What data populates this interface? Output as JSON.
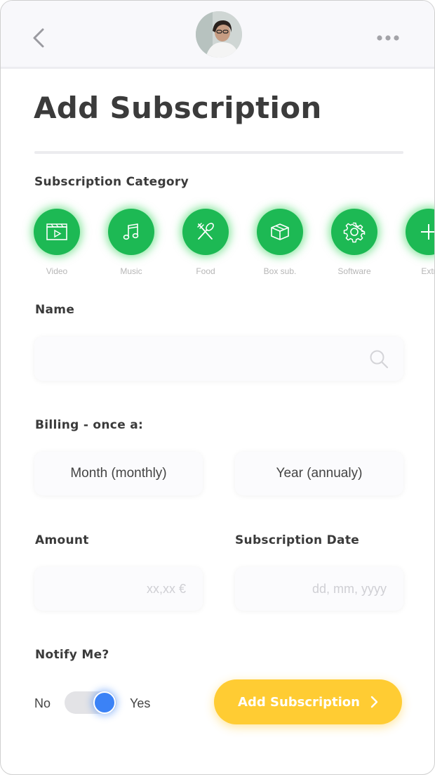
{
  "page": {
    "title": "Add Subscription"
  },
  "header": {
    "back_icon": "chevron-left-icon",
    "avatar": "user-avatar",
    "more_icon": "more-horizontal-icon"
  },
  "category": {
    "label": "Subscription Category",
    "items": [
      {
        "label": "Video",
        "icon": "video-icon"
      },
      {
        "label": "Music",
        "icon": "music-icon"
      },
      {
        "label": "Food",
        "icon": "food-icon"
      },
      {
        "label": "Box sub.",
        "icon": "box-icon"
      },
      {
        "label": "Software",
        "icon": "gear-icon"
      },
      {
        "label": "Extr",
        "icon": "plus-icon"
      }
    ]
  },
  "name": {
    "label": "Name",
    "value": "",
    "placeholder": ""
  },
  "billing": {
    "label": "Billing - once a:",
    "options": [
      "Month (monthly)",
      "Year (annualy)"
    ]
  },
  "amount": {
    "label": "Amount",
    "placeholder": "xx,xx €"
  },
  "date": {
    "label": "Subscription Date",
    "placeholder": "dd, mm, yyyy"
  },
  "notify": {
    "label": "Notify Me?",
    "off_label": "No",
    "on_label": "Yes",
    "enabled": true
  },
  "submit": {
    "label": "Add Subscription"
  },
  "colors": {
    "accent_green": "#1db954",
    "toggle_blue": "#3b82f6",
    "cta_yellow": "#ffcc33"
  }
}
